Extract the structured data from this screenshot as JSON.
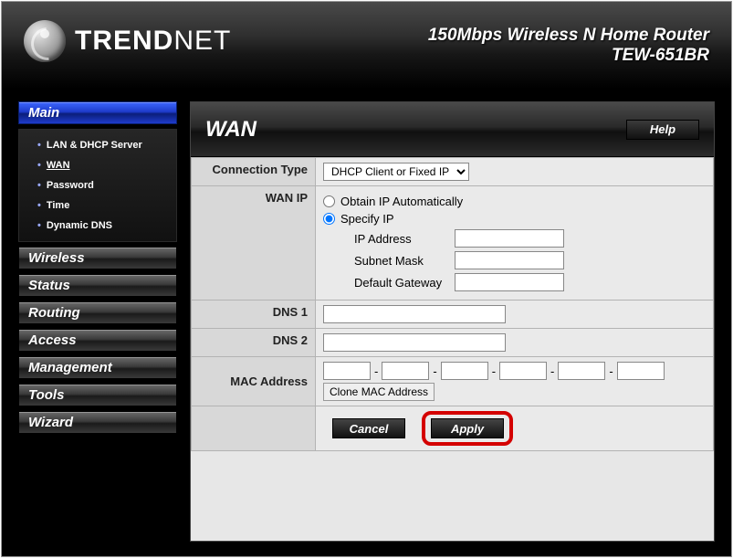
{
  "brand": {
    "name": "TRENDNET"
  },
  "device": {
    "line1": "150Mbps Wireless N Home Router",
    "line2": "TEW-651BR"
  },
  "sidebar": {
    "main": "Main",
    "sub": {
      "lan": "LAN & DHCP Server",
      "wan": "WAN",
      "password": "Password",
      "time": "Time",
      "ddns": "Dynamic DNS"
    },
    "wireless": "Wireless",
    "status": "Status",
    "routing": "Routing",
    "access": "Access",
    "management": "Management",
    "tools": "Tools",
    "wizard": "Wizard"
  },
  "panel": {
    "title": "WAN",
    "help": "Help",
    "labels": {
      "conn_type": "Connection Type",
      "wan_ip": "WAN IP",
      "dns1": "DNS 1",
      "dns2": "DNS 2",
      "mac": "MAC Address",
      "ip_addr": "IP Address",
      "subnet": "Subnet Mask",
      "gateway": "Default Gateway"
    },
    "conn_type_value": "DHCP Client or Fixed IP",
    "radio": {
      "auto": "Obtain IP Automatically",
      "specify": "Specify IP"
    },
    "clone": "Clone MAC Address",
    "buttons": {
      "cancel": "Cancel",
      "apply": "Apply"
    },
    "dash": "-"
  }
}
